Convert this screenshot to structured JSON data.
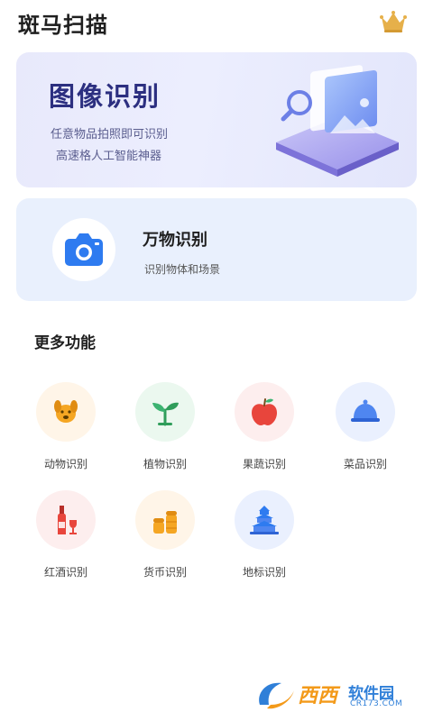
{
  "header": {
    "title": "斑马扫描",
    "vip_icon": "crown-icon"
  },
  "banner": {
    "title": "图像识别",
    "line1": "任意物品拍照即可识别",
    "line2": "高速格人工智能神器",
    "art_icon": "image-recognition-illustration"
  },
  "main_card": {
    "title": "万物识别",
    "subtitle": "识别物体和场景",
    "icon": "camera-icon"
  },
  "section": {
    "title": "更多功能"
  },
  "features": [
    {
      "label": "动物识别",
      "icon": "dog-icon",
      "bg": "#fff5e8"
    },
    {
      "label": "植物识别",
      "icon": "sprout-icon",
      "bg": "#ebf8ef"
    },
    {
      "label": "果蔬识别",
      "icon": "apple-icon",
      "bg": "#fdeeee"
    },
    {
      "label": "菜品识别",
      "icon": "dish-icon",
      "bg": "#eaf0fe"
    },
    {
      "label": "红酒识别",
      "icon": "wine-icon",
      "bg": "#fdeeee"
    },
    {
      "label": "货币识别",
      "icon": "coins-icon",
      "bg": "#fff5e8"
    },
    {
      "label": "地标识别",
      "icon": "landmark-icon",
      "bg": "#eaf0fe"
    }
  ],
  "watermark": {
    "brand": "西西",
    "soft": "软件园",
    "url": "CR173.COM"
  },
  "colors": {
    "accent_blue": "#2e7bf0",
    "banner_title": "#2c2f80",
    "orange": "#f5a623",
    "green": "#3cb371",
    "red": "#e8453c"
  }
}
